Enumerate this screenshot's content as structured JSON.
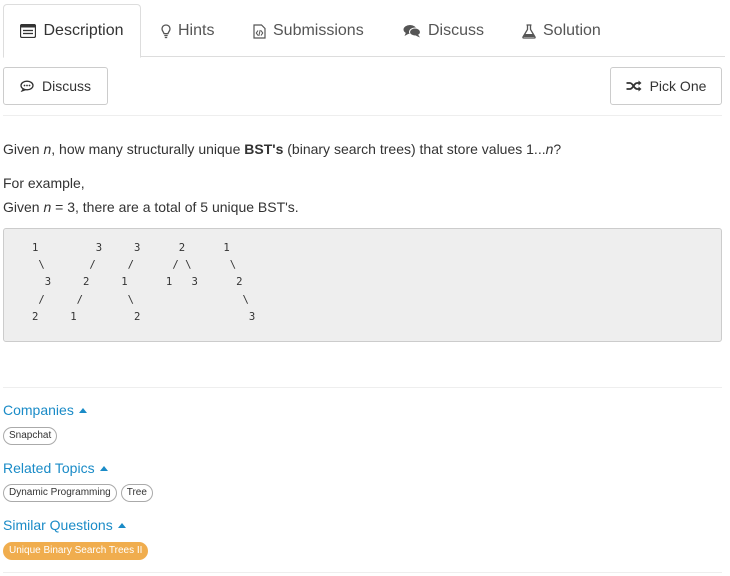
{
  "tabs": {
    "description": "Description",
    "hints": "Hints",
    "submissions": "Submissions",
    "discuss": "Discuss",
    "solution": "Solution"
  },
  "toolbar": {
    "discuss_label": "Discuss",
    "pick_one_label": "Pick One"
  },
  "problem": {
    "given": "Given",
    "n": "n",
    "q_mid": ", how many structurally unique",
    "bst": "BST's",
    "q_end": "(binary search trees) that store values 1...",
    "q_n": "n",
    "q_mark": "?",
    "for_example": "For example,",
    "ex_given": "Given",
    "ex_n": "n",
    "ex_rest": " = 3, there are a total of 5 unique BST's.",
    "code": "1         3     3      2      1\n \\       /     /      / \\      \\\n  3     2     1      1   3      2\n /     /       \\                 \\\n2     1         2                 3"
  },
  "companies": {
    "title": "Companies",
    "tags": [
      "Snapchat"
    ]
  },
  "related_topics": {
    "title": "Related Topics",
    "tags": [
      "Dynamic Programming",
      "Tree"
    ]
  },
  "similar_questions": {
    "title": "Similar Questions",
    "tags": [
      "Unique Binary Search Trees II"
    ]
  },
  "colors": {
    "link": "#1a8bc7",
    "highlight_tag": "#f0ad4e"
  }
}
